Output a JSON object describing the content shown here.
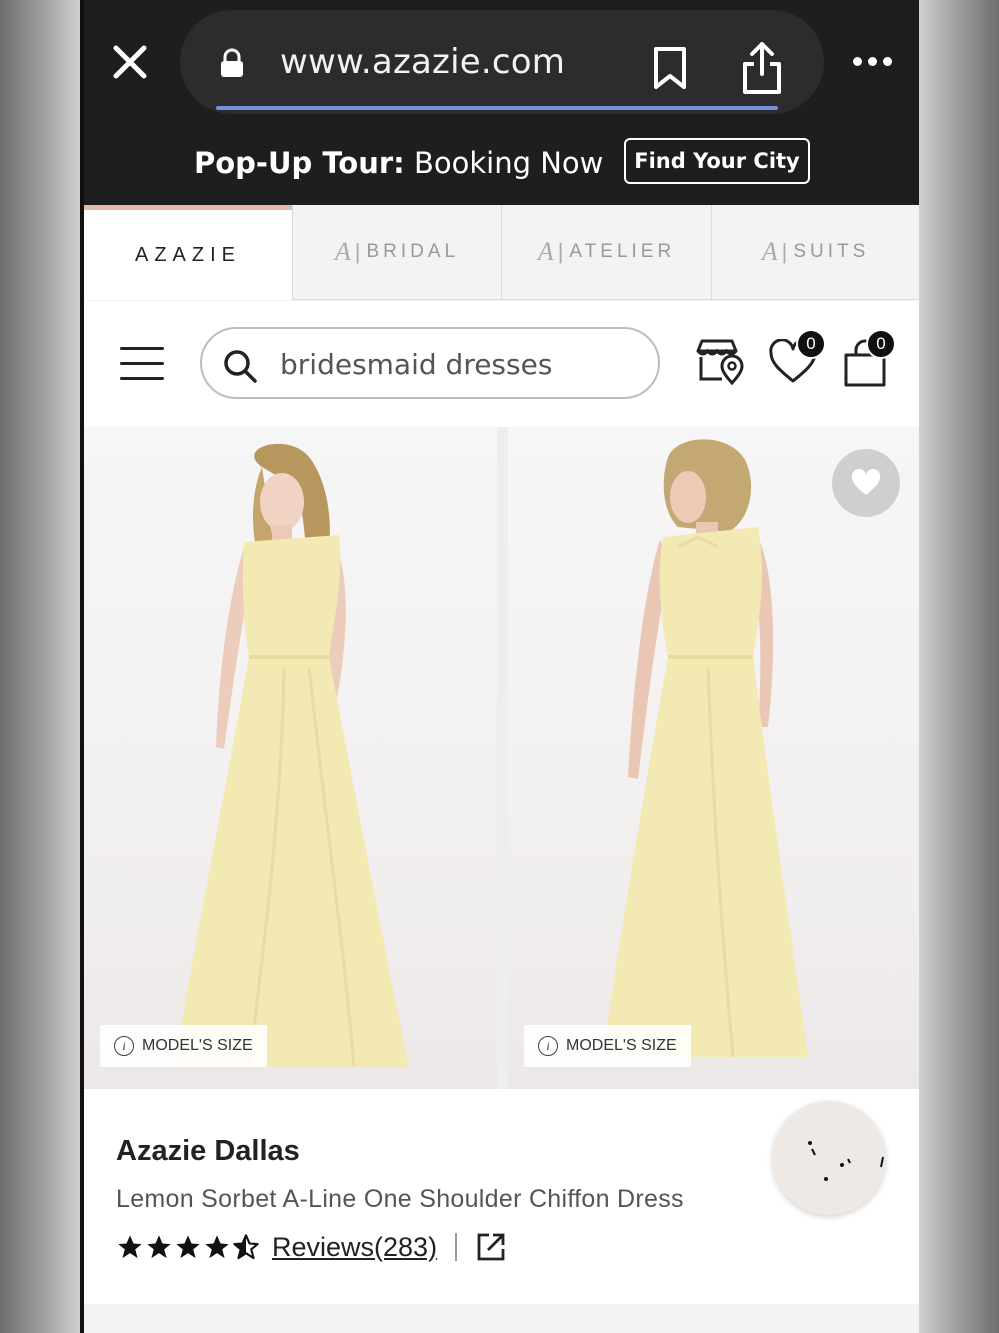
{
  "browser": {
    "url": "www.azazie.com",
    "icons": [
      "close-icon",
      "lock-icon",
      "bookmark-icon",
      "share-icon",
      "more-icon"
    ]
  },
  "promo": {
    "bold": "Pop-Up Tour:",
    "text": " Booking Now",
    "button": "Find Your City"
  },
  "brand_tabs": [
    {
      "label": "AZAZIE"
    },
    {
      "label": "BRIDAL"
    },
    {
      "label": "ATELIER"
    },
    {
      "label": "SUITS"
    }
  ],
  "header": {
    "search_value": "bridesmaid dresses",
    "wishlist_count": "0",
    "cart_count": "0"
  },
  "gallery": {
    "model_size_label": "MODEL'S SIZE",
    "info_glyph": "i"
  },
  "product": {
    "brand": "Azazie Dallas",
    "title": "Lemon Sorbet A-Line One Shoulder Chiffon Dress",
    "rating": 4.5,
    "reviews_label": "Reviews(283)"
  },
  "colors": {
    "dress": "#f3e9b3",
    "accent_tab": "#e8b9a4",
    "browser_bg": "#1e1e1e"
  }
}
